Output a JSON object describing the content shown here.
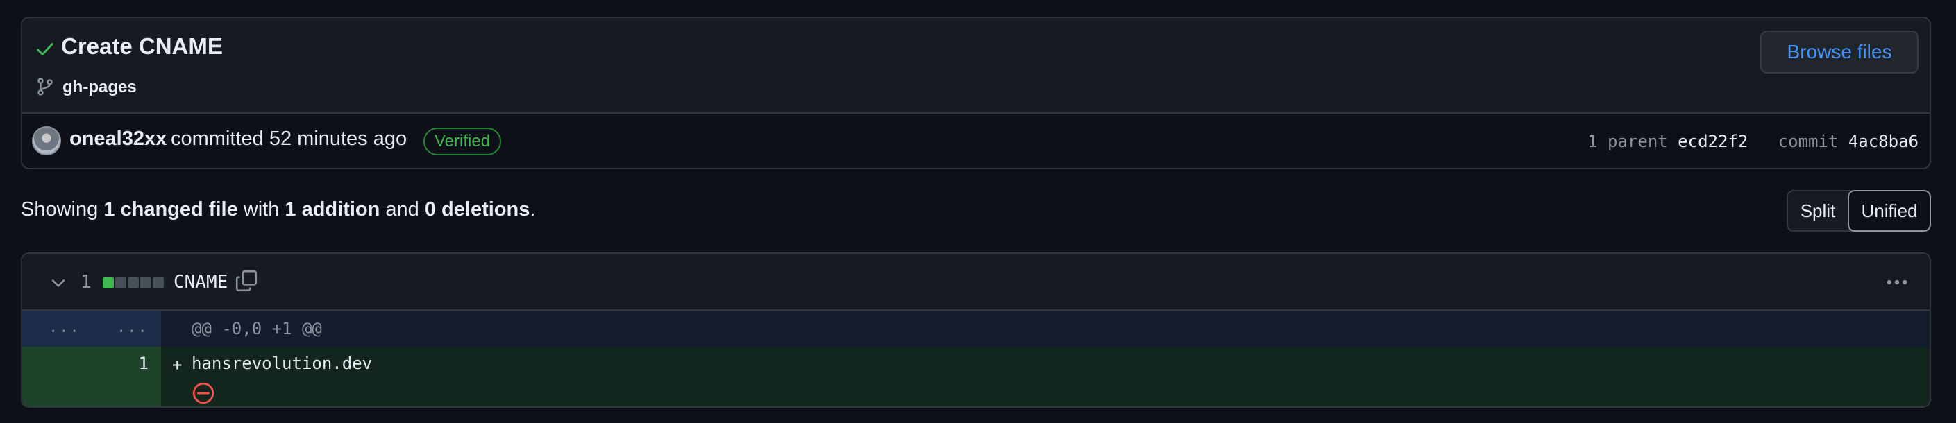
{
  "commit": {
    "title": "Create CNAME",
    "branch": "gh-pages",
    "browse_files_label": "Browse files",
    "author": "oneal32xx",
    "action_text": "committed 52 minutes ago",
    "verified_label": "Verified",
    "parent_label": "1 parent",
    "parent_sha": "ecd22f2",
    "commit_label": "commit",
    "commit_sha": "4ac8ba6"
  },
  "summary": {
    "prefix": "Showing",
    "changed": "1 changed file",
    "with": "with",
    "additions": "1 addition",
    "and": "and",
    "deletions": "0 deletions",
    "suffix": "."
  },
  "view_toggle": {
    "split_label": "Split",
    "unified_label": "Unified",
    "selected": "Unified"
  },
  "file": {
    "change_count": "1",
    "diffstat": {
      "additions": 1,
      "deletions": 0
    },
    "name": "CNAME",
    "hunk_left_dots": "...",
    "hunk_right_dots": "...",
    "hunk_header": "@@ -0,0 +1 @@",
    "lines": [
      {
        "number": "1",
        "sign": "+",
        "text": "hansrevolution.dev"
      }
    ]
  },
  "colors": {
    "background": "#0d1117",
    "accent_link": "#4493f8",
    "success": "#3fb950",
    "added_line_bg": "#12261e",
    "hunk_bg": "#131d2e",
    "no_newline_icon": "#f85149"
  },
  "icons": [
    "check-icon",
    "branch-icon",
    "avatar",
    "chevron-down-icon",
    "copy-icon",
    "kebab-icon",
    "no-newline-icon"
  ]
}
